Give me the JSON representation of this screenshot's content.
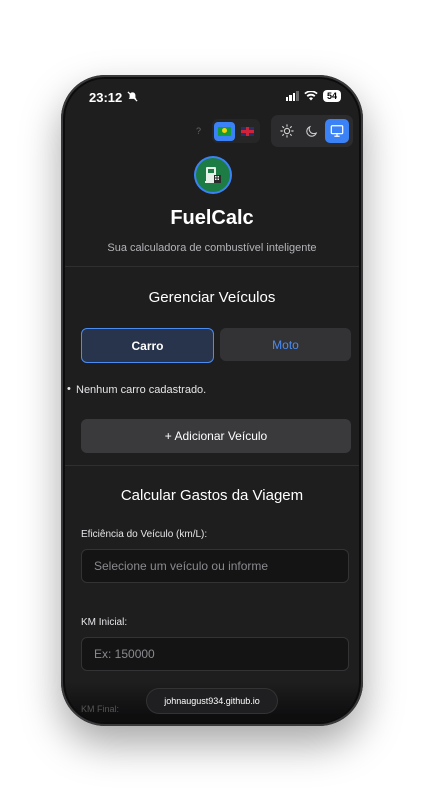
{
  "status_bar": {
    "time": "23:12",
    "battery": "54"
  },
  "toolbar": {
    "help": "?",
    "languages": [
      {
        "code": "pt-BR",
        "icon": "brazil-flag-icon",
        "active": true
      },
      {
        "code": "en-GB",
        "icon": "uk-flag-icon",
        "active": false
      }
    ],
    "themes": [
      {
        "name": "light",
        "icon": "sun-icon",
        "active": false
      },
      {
        "name": "dark",
        "icon": "moon-icon",
        "active": false
      },
      {
        "name": "system",
        "icon": "monitor-icon",
        "active": true
      }
    ]
  },
  "header": {
    "title": "FuelCalc",
    "subtitle": "Sua calculadora de combustível inteligente"
  },
  "vehicles": {
    "title": "Gerenciar Veículos",
    "tabs": [
      "Carro",
      "Moto"
    ],
    "active_tab": "Carro",
    "empty_bullet": "•",
    "empty_message": "Nenhum carro cadastrado.",
    "add_button": "+ Adicionar Veículo"
  },
  "trip": {
    "title": "Calcular Gastos da Viagem",
    "efficiency_label": "Eficiência do Veículo (km/L):",
    "efficiency_placeholder": "Selecione um veículo ou informe",
    "km_start_label": "KM Inicial:",
    "km_start_placeholder": "Ex: 150000",
    "km_end_label": "KM Final:"
  },
  "browser": {
    "url": "johnaugust934.github.io"
  },
  "colors": {
    "accent": "#3b82f6",
    "background": "#1e1e1f",
    "logo_green": "#1c7c43"
  }
}
